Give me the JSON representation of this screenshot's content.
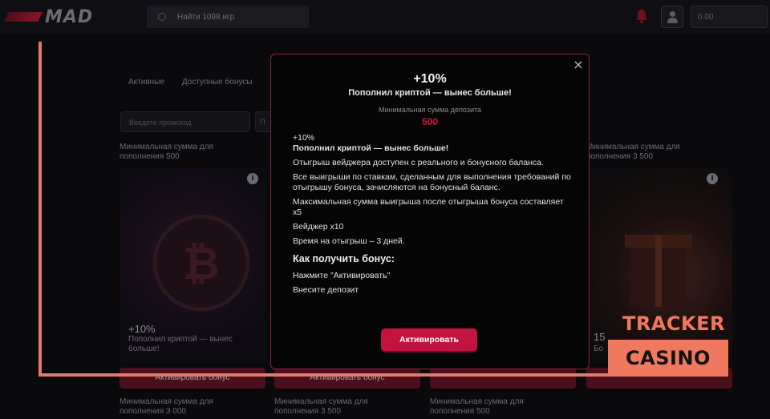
{
  "header": {
    "logo_text": "MAD",
    "search_placeholder": "Найти 1098 игр",
    "balance": "0.00"
  },
  "tabs": [
    "Активные",
    "Доступные бонусы"
  ],
  "filter": {
    "placeholder": "Введите промокод",
    "button_label": "П"
  },
  "cards": [
    {
      "label": "Минимальная сумма для пополнения 500",
      "title": "+10%",
      "subtitle": "Пополнил криптой — вынес больше!",
      "button": "Активировать бонус"
    },
    {
      "label": "",
      "title": "",
      "subtitle": "",
      "button": "Активировать бонус"
    },
    {
      "label": "",
      "title": "",
      "subtitle": "",
      "button": ""
    },
    {
      "label": "Минимальная сумма для пополнения 3 500",
      "title": "15",
      "subtitle": "Бо",
      "button": ""
    }
  ],
  "bottom_labels": [
    "Минимальная сумма для пополнения 3 000",
    "Минимальная сумма для пополнения 3 500",
    "Минимальная сумма для пополнения 500"
  ],
  "modal": {
    "close_glyph": "×",
    "percent": "+10%",
    "heading": "Пополнил криптой — вынес больше!",
    "min_label": "Минимальная сумма депозита",
    "min_value": "500",
    "body_percent": "+10%",
    "body_title": "Пополнил криптой — вынес больше!",
    "rules": [
      "Отыгрыш вейджера доступен с реального и бонусного баланса.",
      "Все выигрыши по ставкам, сделанным для выполнения требований по отыгрышу бонуса, зачисляются на бонусный баланс.",
      "Максимальная сумма выигрыша после отыгрыша бонуса составляет x5",
      "Вейджер x10",
      "Время на отыгрыш – 3 дней."
    ],
    "how_title": "Как получить бонус:",
    "steps": [
      "Нажмите \"Активировать\"",
      "Внесите депозит"
    ],
    "activate_label": "Активировать"
  },
  "watermark": {
    "line1": "TRACKER",
    "line2": "CASINO"
  },
  "colors": {
    "accent": "#c2143f",
    "watermark": "#f0785f",
    "modal_border": "#8c1f36"
  }
}
